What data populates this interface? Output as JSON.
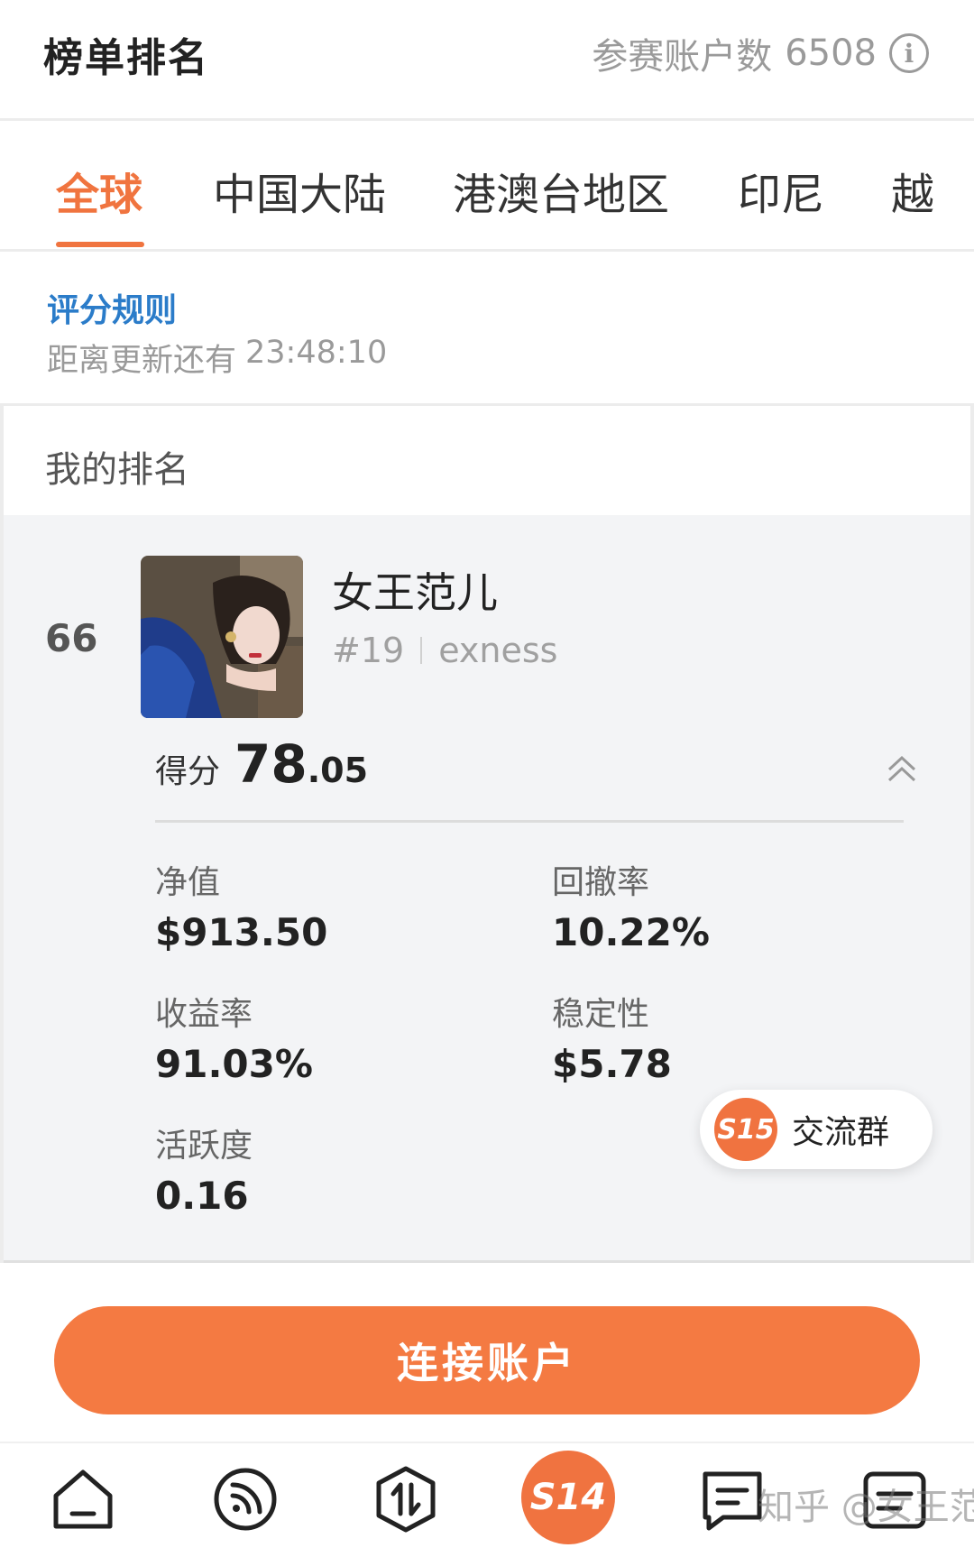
{
  "header": {
    "title": "榜单排名",
    "accounts_label": "参赛账户数",
    "accounts_count": "6508"
  },
  "tabs": [
    {
      "label": "全球",
      "active": true
    },
    {
      "label": "中国大陆",
      "active": false
    },
    {
      "label": "港澳台地区",
      "active": false
    },
    {
      "label": "印尼",
      "active": false
    },
    {
      "label": "越",
      "active": false
    }
  ],
  "rules": {
    "link_label": "评分规则",
    "countdown_label": "距离更新还有",
    "countdown_time": "23:48:10"
  },
  "my_ranking": {
    "section_title": "我的排名",
    "rank": "66",
    "username": "女王范儿",
    "sub_rank": "#19",
    "broker": "exness",
    "score_label": "得分",
    "score_int": "78",
    "score_dec": ".05",
    "stats": {
      "net_value": {
        "label": "净值",
        "value": "$913.50"
      },
      "drawdown": {
        "label": "回撤率",
        "value": "10.22%"
      },
      "return_rate": {
        "label": "收益率",
        "value": "91.03%"
      },
      "stability": {
        "label": "稳定性",
        "value": "$5.78"
      },
      "activity": {
        "label": "活跃度",
        "value": "0.16"
      }
    }
  },
  "chat_group": {
    "badge": "S15",
    "label": "交流群"
  },
  "connect_button": "连接账户",
  "bottom_nav": {
    "center_badge": "S14",
    "watermark": "知乎 @女王范儿"
  },
  "colors": {
    "accent": "#f0743f",
    "link": "#2b7cc9",
    "card_bg": "#f3f4f6"
  },
  "icons": [
    "info-icon",
    "collapse-up-icon",
    "home-icon",
    "feed-icon",
    "trade-icon",
    "message-icon",
    "profile-icon"
  ]
}
